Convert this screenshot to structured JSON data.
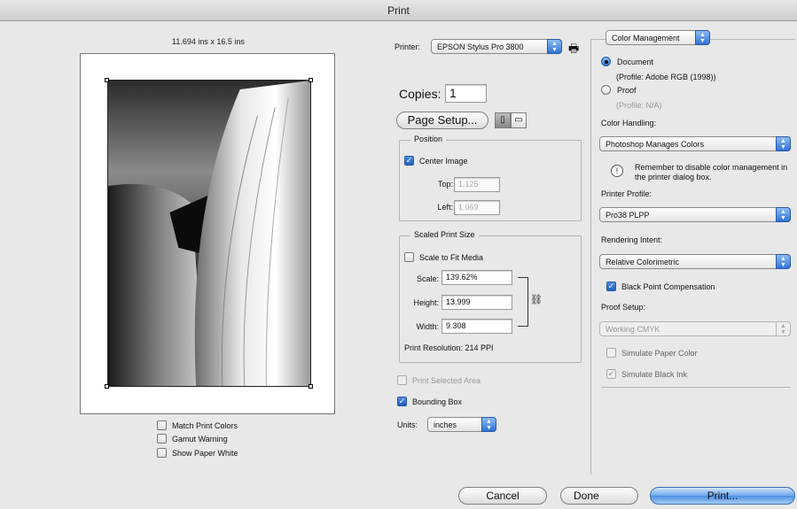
{
  "window": {
    "title": "Print"
  },
  "preview": {
    "paper_size": "11.694 ins x 16.5 ins",
    "options": [
      {
        "label": "Match Print Colors",
        "checked": false
      },
      {
        "label": "Gamut Warning",
        "checked": false
      },
      {
        "label": "Show Paper White",
        "checked": false
      }
    ]
  },
  "printer": {
    "label": "Printer:",
    "value": "EPSON Stylus Pro 3800"
  },
  "copies": {
    "label": "Copies:",
    "value": "1"
  },
  "page_setup": {
    "label": "Page Setup..."
  },
  "position": {
    "title": "Position",
    "center_image": {
      "label": "Center Image",
      "checked": true
    },
    "top": {
      "label": "Top:",
      "value": "1.125"
    },
    "left": {
      "label": "Left:",
      "value": "1.069"
    }
  },
  "scaled_print_size": {
    "title": "Scaled Print Size",
    "scale_to_fit": {
      "label": "Scale to Fit Media",
      "checked": false
    },
    "scale": {
      "label": "Scale:",
      "value": "139.62%"
    },
    "height": {
      "label": "Height:",
      "value": "13.999"
    },
    "width": {
      "label": "Width:",
      "value": "9.308"
    },
    "resolution": "Print Resolution: 214 PPI"
  },
  "print_selected_area": {
    "label": "Print Selected Area",
    "checked": false
  },
  "bounding_box": {
    "label": "Bounding Box",
    "checked": true
  },
  "units": {
    "label": "Units:",
    "value": "inches"
  },
  "color_management": {
    "section": "Color Management",
    "document": {
      "label": "Document",
      "profile": "(Profile: Adobe RGB (1998))",
      "selected": true
    },
    "proof": {
      "label": "Proof",
      "profile": "(Profile: N/A)",
      "selected": false
    },
    "color_handling": {
      "label": "Color Handling:",
      "value": "Photoshop Manages Colors"
    },
    "note": "Remember to disable color management in the printer dialog box.",
    "printer_profile": {
      "label": "Printer Profile:",
      "value": "Pro38 PLPP"
    },
    "rendering_intent": {
      "label": "Rendering Intent:",
      "value": "Relative Colorimetric"
    },
    "black_point": {
      "label": "Black Point Compensation",
      "checked": true
    },
    "proof_setup": {
      "label": "Proof Setup:",
      "value": "Working CMYK"
    },
    "simulate_paper": {
      "label": "Simulate Paper Color",
      "checked": false
    },
    "simulate_ink": {
      "label": "Simulate Black Ink",
      "checked": true
    }
  },
  "buttons": {
    "cancel": "Cancel",
    "done": "Done",
    "print": "Print..."
  },
  "glyphs": {
    "check": "✓",
    "up_down": "▲▼",
    "chain": "⛓",
    "printer": "🖶",
    "warning": "!"
  }
}
